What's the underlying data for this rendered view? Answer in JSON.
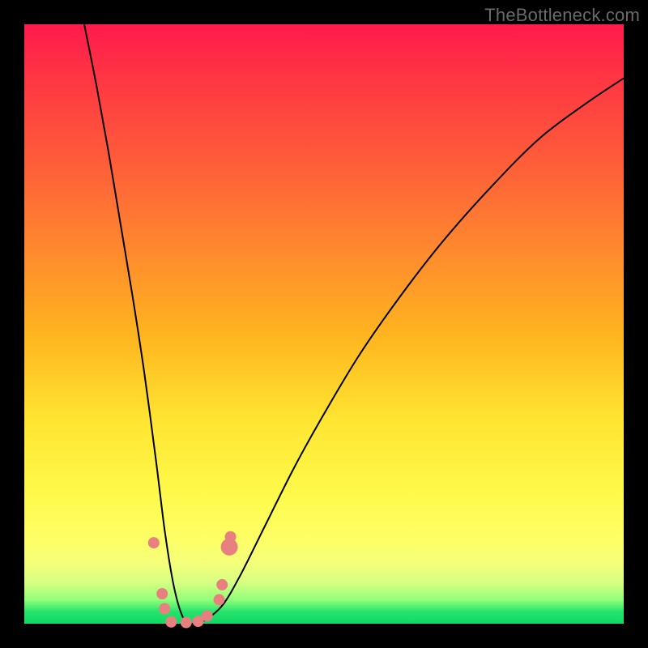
{
  "watermark": "TheBottleneck.com",
  "colors": {
    "frame": "#000000",
    "curve": "#000000",
    "marker_fill": "#e98080",
    "marker_stroke": "#d06a6a",
    "gradient_top": "#ff1a4d",
    "gradient_bottom": "#10d964"
  },
  "chart_data": {
    "type": "line",
    "title": "",
    "xlabel": "",
    "ylabel": "",
    "xlim": [
      0,
      100
    ],
    "ylim": [
      0,
      100
    ],
    "grid": false,
    "legend": false,
    "series": [
      {
        "name": "bottleneck-curve",
        "x": [
          10,
          12,
          14,
          16,
          18,
          20,
          22,
          23.5,
          25,
          26.5,
          28,
          30,
          33,
          36,
          40,
          45,
          50,
          56,
          63,
          70,
          78,
          86,
          94,
          100
        ],
        "y": [
          100,
          90,
          79,
          67,
          55,
          42,
          27,
          15,
          6,
          1,
          0,
          0.5,
          3,
          8,
          16,
          26,
          35,
          45,
          55,
          64,
          73,
          81,
          87,
          91
        ]
      }
    ],
    "markers": [
      {
        "x": 21.6,
        "y": 13.5,
        "r": 1.0
      },
      {
        "x": 23.0,
        "y": 5.0,
        "r": 1.0
      },
      {
        "x": 23.4,
        "y": 2.5,
        "r": 1.0
      },
      {
        "x": 24.5,
        "y": 0.3,
        "r": 1.0
      },
      {
        "x": 27.0,
        "y": 0.2,
        "r": 1.0
      },
      {
        "x": 29.0,
        "y": 0.4,
        "r": 1.0
      },
      {
        "x": 30.5,
        "y": 1.3,
        "r": 1.0
      },
      {
        "x": 32.5,
        "y": 4.0,
        "r": 1.0
      },
      {
        "x": 33.0,
        "y": 6.5,
        "r": 1.0
      },
      {
        "x": 34.2,
        "y": 12.8,
        "r": 1.5
      },
      {
        "x": 34.4,
        "y": 14.5,
        "r": 1.0
      }
    ]
  }
}
